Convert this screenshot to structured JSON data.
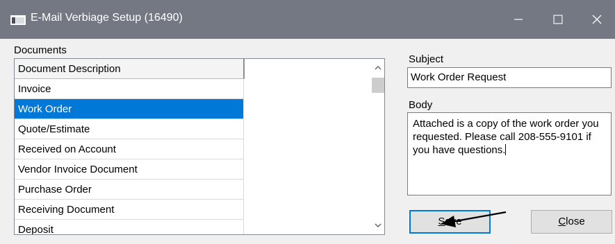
{
  "window": {
    "title": "E-Mail Verbiage Setup (16490)"
  },
  "documents": {
    "label": "Documents",
    "column_header": "Document Description",
    "items": [
      "Invoice",
      "Work Order",
      "Quote/Estimate",
      "Received on Account",
      "Vendor Invoice Document",
      "Purchase Order",
      "Receiving Document",
      "Deposit"
    ],
    "selected_item": "Work Order"
  },
  "subject": {
    "label": "Subject",
    "value": "Work Order Request"
  },
  "body": {
    "label": "Body",
    "value": "Attached is a copy of the work order you requested. Please call 208-555-9101 if you have questions."
  },
  "buttons": {
    "save": {
      "pre": "",
      "accel": "S",
      "post": "ave"
    },
    "close": {
      "pre": "",
      "accel": "C",
      "post": "lose"
    }
  },
  "colors": {
    "titlebar": "#737882",
    "selection": "#0078d7"
  },
  "icons": {
    "app": "app-window-icon",
    "minimize": "minimize-icon",
    "maximize": "maximize-icon",
    "close": "close-icon",
    "scroll_up": "scroll-up-arrow-icon",
    "scroll_down": "scroll-down-arrow-icon"
  }
}
